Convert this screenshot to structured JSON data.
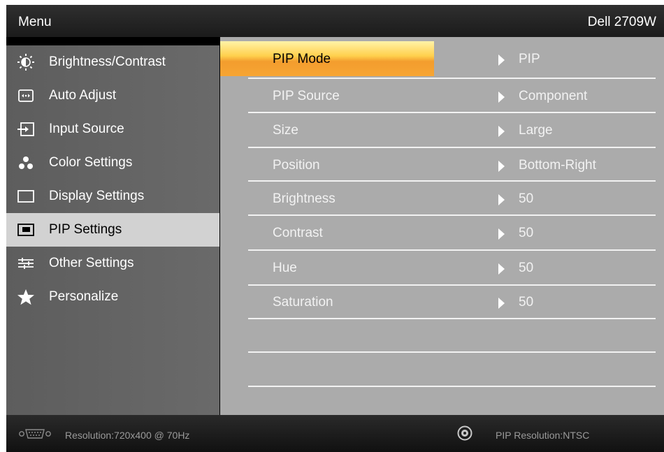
{
  "header": {
    "menu_title": "Menu",
    "model": "Dell 2709W"
  },
  "sidebar": {
    "items": [
      {
        "label": "Brightness/Contrast",
        "icon": "brightness-icon",
        "selected": false
      },
      {
        "label": "Auto Adjust",
        "icon": "auto-adjust-icon",
        "selected": false
      },
      {
        "label": "Input Source",
        "icon": "input-source-icon",
        "selected": false
      },
      {
        "label": "Color Settings",
        "icon": "color-settings-icon",
        "selected": false
      },
      {
        "label": "Display Settings",
        "icon": "display-settings-icon",
        "selected": false
      },
      {
        "label": "PIP Settings",
        "icon": "pip-settings-icon",
        "selected": true
      },
      {
        "label": "Other Settings",
        "icon": "other-settings-icon",
        "selected": false
      },
      {
        "label": "Personalize",
        "icon": "star-icon",
        "selected": false
      }
    ]
  },
  "main": {
    "rows": [
      {
        "label": "PIP Mode",
        "value": "PIP",
        "selected": true
      },
      {
        "label": "PIP Source",
        "value": "Component",
        "selected": false
      },
      {
        "label": "Size",
        "value": "Large",
        "selected": false
      },
      {
        "label": "Position",
        "value": "Bottom-Right",
        "selected": false
      },
      {
        "label": "Brightness",
        "value": "50",
        "selected": false
      },
      {
        "label": "Contrast",
        "value": "50",
        "selected": false
      },
      {
        "label": "Hue",
        "value": "50",
        "selected": false
      },
      {
        "label": "Saturation",
        "value": "50",
        "selected": false
      }
    ]
  },
  "footer": {
    "resolution": "Resolution:720x400 @ 70Hz",
    "pip_resolution": "PIP Resolution:NTSC",
    "input_icon": "vga-connector-icon",
    "pip_icon": "component-input-icon"
  },
  "colors": {
    "highlight": "#ffd04d",
    "sidebar": "#646464",
    "content": "#ababab",
    "selected_sidebar": "#d2d2d2"
  }
}
